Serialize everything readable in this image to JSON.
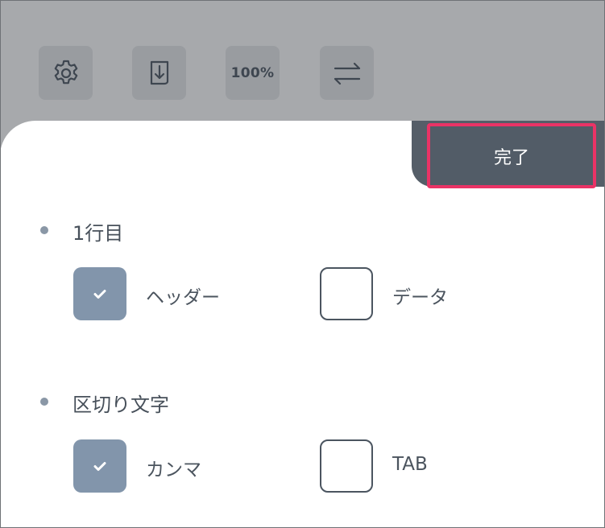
{
  "toolbar": {
    "settings_icon": "gear-icon",
    "import_icon": "download-document-icon",
    "zoom_label": "100%",
    "swap_icon": "swap-arrows-icon"
  },
  "done_button": {
    "label": "完了"
  },
  "sections": [
    {
      "title": "1行目",
      "options": [
        {
          "label": "ヘッダー",
          "checked": true
        },
        {
          "label": "データ",
          "checked": false
        }
      ]
    },
    {
      "title": "区切り文字",
      "options": [
        {
          "label": "カンマ",
          "checked": true
        },
        {
          "label": "TAB",
          "checked": false
        }
      ]
    }
  ],
  "colors": {
    "accent_checked": "#8295ab",
    "done_bg": "#525c67",
    "highlight": "#ea3366",
    "toolbar_bg": "#a7a9ac"
  }
}
